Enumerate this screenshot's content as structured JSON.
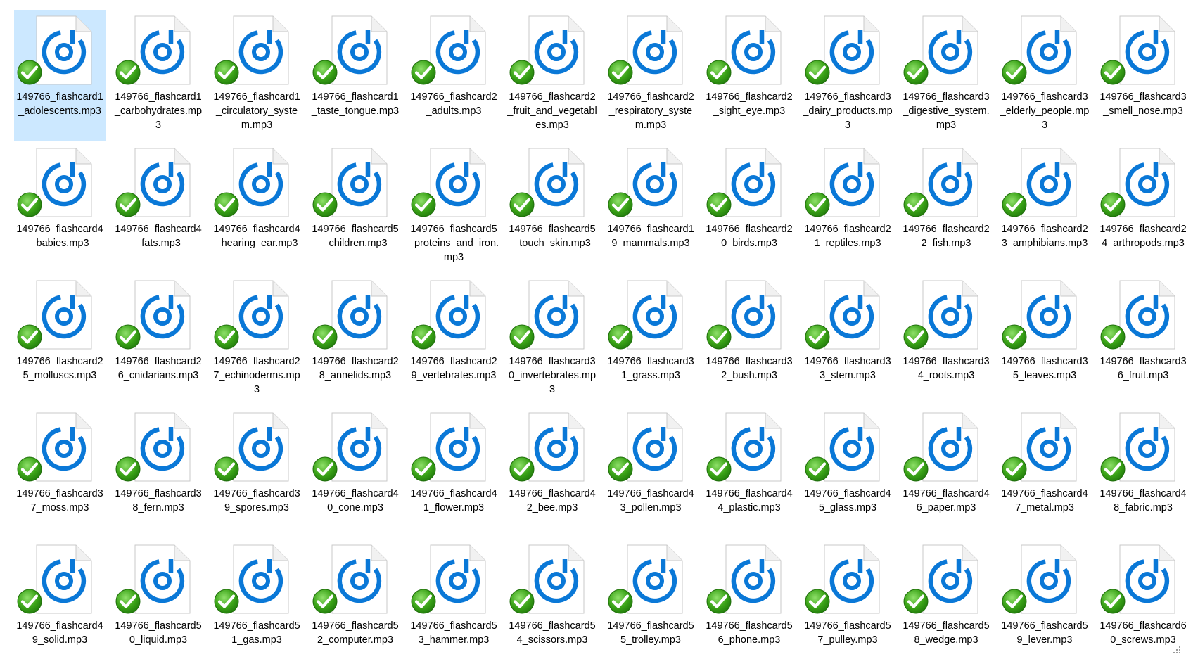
{
  "window": {
    "view": "Large icons"
  },
  "colors": {
    "selection": "#cce8ff",
    "accent_blue": "#0a78d7",
    "check_green": "#3aa317",
    "page_bg": "#ffffff"
  },
  "icons": {
    "file": "audio-file-icon",
    "sync": "sync-check-icon"
  },
  "files": [
    {
      "name": "149766_flashcard1_adolescents.mp3",
      "selected": true
    },
    {
      "name": "149766_flashcard1_carbohydrates.mp3"
    },
    {
      "name": "149766_flashcard1_circulatory_system.mp3"
    },
    {
      "name": "149766_flashcard1_taste_tongue.mp3"
    },
    {
      "name": "149766_flashcard2_adults.mp3"
    },
    {
      "name": "149766_flashcard2_fruit_and_vegetables.mp3"
    },
    {
      "name": "149766_flashcard2_respiratory_system.mp3"
    },
    {
      "name": "149766_flashcard2_sight_eye.mp3"
    },
    {
      "name": "149766_flashcard3_dairy_products.mp3"
    },
    {
      "name": "149766_flashcard3_digestive_system.mp3"
    },
    {
      "name": "149766_flashcard3_elderly_people.mp3"
    },
    {
      "name": "149766_flashcard3_smell_nose.mp3"
    },
    {
      "name": "149766_flashcard4_babies.mp3"
    },
    {
      "name": "149766_flashcard4_fats.mp3"
    },
    {
      "name": "149766_flashcard4_hearing_ear.mp3"
    },
    {
      "name": "149766_flashcard5_children.mp3"
    },
    {
      "name": "149766_flashcard5_proteins_and_iron.mp3"
    },
    {
      "name": "149766_flashcard5_touch_skin.mp3"
    },
    {
      "name": "149766_flashcard19_mammals.mp3"
    },
    {
      "name": "149766_flashcard20_birds.mp3"
    },
    {
      "name": "149766_flashcard21_reptiles.mp3"
    },
    {
      "name": "149766_flashcard22_fish.mp3"
    },
    {
      "name": "149766_flashcard23_amphibians.mp3"
    },
    {
      "name": "149766_flashcard24_arthropods.mp3"
    },
    {
      "name": "149766_flashcard25_molluscs.mp3"
    },
    {
      "name": "149766_flashcard26_cnidarians.mp3"
    },
    {
      "name": "149766_flashcard27_echinoderms.mp3"
    },
    {
      "name": "149766_flashcard28_annelids.mp3"
    },
    {
      "name": "149766_flashcard29_vertebrates.mp3"
    },
    {
      "name": "149766_flashcard30_invertebrates.mp3"
    },
    {
      "name": "149766_flashcard31_grass.mp3"
    },
    {
      "name": "149766_flashcard32_bush.mp3"
    },
    {
      "name": "149766_flashcard33_stem.mp3"
    },
    {
      "name": "149766_flashcard34_roots.mp3"
    },
    {
      "name": "149766_flashcard35_leaves.mp3"
    },
    {
      "name": "149766_flashcard36_fruit.mp3"
    },
    {
      "name": "149766_flashcard37_moss.mp3"
    },
    {
      "name": "149766_flashcard38_fern.mp3"
    },
    {
      "name": "149766_flashcard39_spores.mp3"
    },
    {
      "name": "149766_flashcard40_cone.mp3"
    },
    {
      "name": "149766_flashcard41_flower.mp3"
    },
    {
      "name": "149766_flashcard42_bee.mp3"
    },
    {
      "name": "149766_flashcard43_pollen.mp3"
    },
    {
      "name": "149766_flashcard44_plastic.mp3"
    },
    {
      "name": "149766_flashcard45_glass.mp3"
    },
    {
      "name": "149766_flashcard46_paper.mp3"
    },
    {
      "name": "149766_flashcard47_metal.mp3"
    },
    {
      "name": "149766_flashcard48_fabric.mp3"
    },
    {
      "name": "149766_flashcard49_solid.mp3"
    },
    {
      "name": "149766_flashcard50_liquid.mp3"
    },
    {
      "name": "149766_flashcard51_gas.mp3"
    },
    {
      "name": "149766_flashcard52_computer.mp3"
    },
    {
      "name": "149766_flashcard53_hammer.mp3"
    },
    {
      "name": "149766_flashcard54_scissors.mp3"
    },
    {
      "name": "149766_flashcard55_trolley.mp3"
    },
    {
      "name": "149766_flashcard56_phone.mp3"
    },
    {
      "name": "149766_flashcard57_pulley.mp3"
    },
    {
      "name": "149766_flashcard58_wedge.mp3"
    },
    {
      "name": "149766_flashcard59_lever.mp3"
    },
    {
      "name": "149766_flashcard60_screws.mp3"
    }
  ]
}
